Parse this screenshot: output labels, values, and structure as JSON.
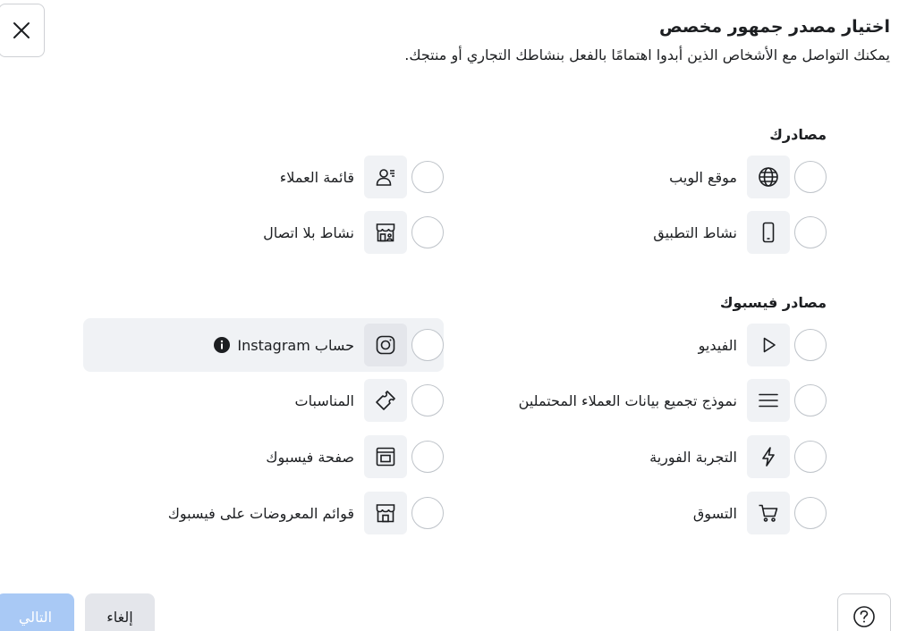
{
  "dialog": {
    "title": "اختيار مصدر جمهور مخصص",
    "subtitle": "يمكنك التواصل مع الأشخاص الذين أبدوا اهتمامًا بالفعل بنشاطك التجاري أو منتجك."
  },
  "sections": {
    "your_sources": {
      "heading": "مصادرك",
      "options": [
        {
          "label": "موقع الويب",
          "icon": "globe-icon"
        },
        {
          "label": "قائمة العملاء",
          "icon": "customer-list-icon"
        },
        {
          "label": "نشاط التطبيق",
          "icon": "mobile-icon"
        },
        {
          "label": "نشاط بلا اتصال",
          "icon": "store-icon"
        }
      ]
    },
    "facebook_sources": {
      "heading": "مصادر فيسبوك",
      "options": [
        {
          "label": "الفيديو",
          "icon": "play-icon"
        },
        {
          "label": "حساب Instagram",
          "icon": "instagram-icon"
        },
        {
          "label": "نموذج تجميع بيانات العملاء المحتملين",
          "icon": "form-lines-icon"
        },
        {
          "label": "المناسبات",
          "icon": "ticket-icon"
        },
        {
          "label": "التجربة الفورية",
          "icon": "lightning-icon"
        },
        {
          "label": "صفحة فيسبوك",
          "icon": "page-icon"
        },
        {
          "label": "التسوق",
          "icon": "cart-icon"
        },
        {
          "label": "قوائم المعروضات على فيسبوك",
          "icon": "marketplace-icon"
        }
      ]
    }
  },
  "footer": {
    "cancel_label": "إلغاء",
    "next_label": "التالي"
  },
  "colors": {
    "accent_disabled": "#a9c9f5",
    "icon_bg": "#f0f2f5",
    "radio_border": "#bec3c9"
  }
}
